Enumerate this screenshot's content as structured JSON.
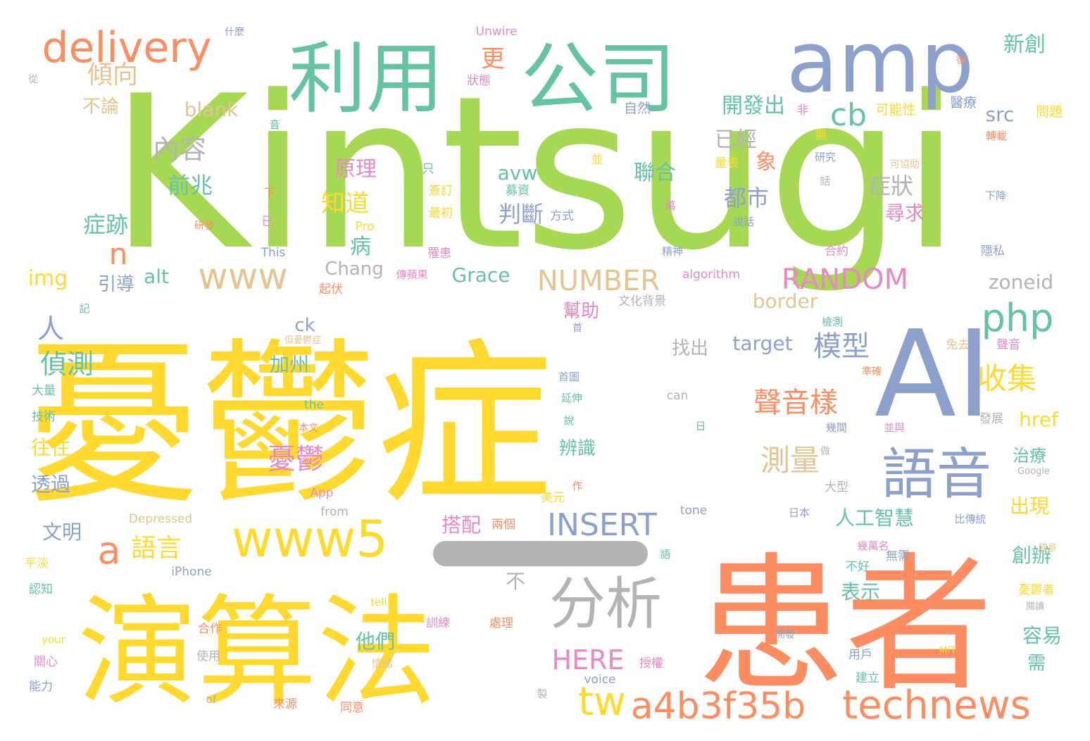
{
  "palette": {
    "green": "#a6d854",
    "yellow": "#ffd92f",
    "orange": "#fc8d62",
    "blue": "#8da0cb",
    "teal": "#66c2a5",
    "pink": "#e78ac3",
    "tan": "#e5c494",
    "gray": "#b3b3b3"
  },
  "words": [
    {
      "text": "Kintsugi",
      "color": "green"
    },
    {
      "text": "憂鬱症",
      "color": "yellow"
    },
    {
      "text": "患者",
      "color": "orange"
    },
    {
      "text": "演算法",
      "color": "yellow"
    },
    {
      "text": "AI",
      "color": "blue"
    },
    {
      "text": "amp",
      "color": "blue"
    },
    {
      "text": "利用",
      "color": "teal"
    },
    {
      "text": "公司",
      "color": "teal"
    },
    {
      "text": "delivery",
      "color": "orange"
    },
    {
      "text": "分析",
      "color": "gray"
    },
    {
      "text": "語音",
      "color": "blue"
    },
    {
      "text": "www5",
      "color": "yellow"
    },
    {
      "text": "technews",
      "color": "orange"
    },
    {
      "text": "a4b3f35b",
      "color": "orange"
    },
    {
      "text": "tw",
      "color": "yellow"
    },
    {
      "text": "php",
      "color": "teal"
    },
    {
      "text": "www",
      "color": "tan"
    },
    {
      "text": "a",
      "color": "orange"
    },
    {
      "text": "n",
      "color": "orange"
    },
    {
      "text": "INSERT",
      "color": "blue"
    },
    {
      "text": "RANDOM",
      "color": "pink"
    },
    {
      "text": "NUMBER",
      "color": "tan"
    },
    {
      "text": "HERE",
      "color": "pink"
    },
    {
      "text": "cb",
      "color": "teal"
    },
    {
      "text": "傾向",
      "color": "tan"
    },
    {
      "text": "更",
      "color": "orange"
    },
    {
      "text": "內容",
      "color": "gray"
    },
    {
      "text": "聲音樣",
      "color": "orange"
    },
    {
      "text": "模型",
      "color": "blue"
    },
    {
      "text": "收集",
      "color": "yellow"
    },
    {
      "text": "測量",
      "color": "tan"
    },
    {
      "text": "憂鬱",
      "color": "pink"
    },
    {
      "text": "偵測",
      "color": "teal"
    },
    {
      "text": "語言",
      "color": "yellow"
    },
    {
      "text": "人",
      "color": "blue"
    },
    {
      "text": "前兆",
      "color": "teal"
    },
    {
      "text": "症跡",
      "color": "teal"
    },
    {
      "text": "知道",
      "color": "yellow"
    },
    {
      "text": "判斷",
      "color": "blue"
    },
    {
      "text": "都市",
      "color": "blue"
    },
    {
      "text": "症狀",
      "color": "gray"
    },
    {
      "text": "開發出",
      "color": "teal"
    },
    {
      "text": "已經",
      "color": "gray"
    },
    {
      "text": "聯合",
      "color": "teal"
    },
    {
      "text": "象",
      "color": "orange"
    },
    {
      "text": "尋求",
      "color": "pink"
    },
    {
      "text": "新創",
      "color": "teal"
    },
    {
      "text": "原理",
      "color": "pink"
    },
    {
      "text": "病",
      "color": "teal"
    },
    {
      "text": "avw",
      "color": "teal"
    },
    {
      "text": "blank",
      "color": "tan"
    },
    {
      "text": "src",
      "color": "blue"
    },
    {
      "text": "img",
      "color": "yellow"
    },
    {
      "text": "alt",
      "color": "teal"
    },
    {
      "text": "Chang",
      "color": "gray"
    },
    {
      "text": "Grace",
      "color": "teal"
    },
    {
      "text": "zoneid",
      "color": "gray"
    },
    {
      "text": "border",
      "color": "tan"
    },
    {
      "text": "ck",
      "color": "blue"
    },
    {
      "text": "target",
      "color": "blue"
    },
    {
      "text": "href",
      "color": "yellow"
    },
    {
      "text": "引導",
      "color": "blue"
    },
    {
      "text": "不論",
      "color": "tan"
    },
    {
      "text": "幫助",
      "color": "pink"
    },
    {
      "text": "找出",
      "color": "gray"
    },
    {
      "text": "加州",
      "color": "teal"
    },
    {
      "text": "人工智慧",
      "color": "teal"
    },
    {
      "text": "出現",
      "color": "yellow"
    },
    {
      "text": "搭配",
      "color": "pink"
    },
    {
      "text": "往往",
      "color": "yellow"
    },
    {
      "text": "透過",
      "color": "blue"
    },
    {
      "text": "文明",
      "color": "blue"
    },
    {
      "text": "表示",
      "color": "teal"
    },
    {
      "text": "容易",
      "color": "teal"
    },
    {
      "text": "創辦",
      "color": "teal"
    },
    {
      "text": "需",
      "color": "teal"
    },
    {
      "text": "他們",
      "color": "teal"
    },
    {
      "text": "不",
      "color": "gray"
    },
    {
      "text": "治療",
      "color": "teal"
    },
    {
      "text": "辨識",
      "color": "teal"
    },
    {
      "text": "Unwire",
      "color": "pink"
    },
    {
      "text": "什麼",
      "color": "blue"
    },
    {
      "text": "從",
      "color": "gray"
    },
    {
      "text": "狀態",
      "color": "pink"
    },
    {
      "text": "自然",
      "color": "blue"
    },
    {
      "text": "非",
      "color": "pink"
    },
    {
      "text": "可能性",
      "color": "yellow"
    },
    {
      "text": "醫療",
      "color": "blue"
    },
    {
      "text": "問題",
      "color": "yellow"
    },
    {
      "text": "後",
      "color": "orange"
    },
    {
      "text": "轉載",
      "color": "orange"
    },
    {
      "text": "音",
      "color": "teal"
    },
    {
      "text": "無",
      "color": "yellow"
    },
    {
      "text": "研究",
      "color": "blue"
    },
    {
      "text": "並",
      "color": "yellow"
    },
    {
      "text": "量表",
      "color": "yellow"
    },
    {
      "text": "可協助",
      "color": "tan"
    },
    {
      "text": "只",
      "color": "teal"
    },
    {
      "text": "簽訂",
      "color": "yellow"
    },
    {
      "text": "最初",
      "color": "yellow"
    },
    {
      "text": "募資",
      "color": "teal"
    },
    {
      "text": "話",
      "color": "gray"
    },
    {
      "text": "下降",
      "color": "blue"
    },
    {
      "text": "下",
      "color": "orange"
    },
    {
      "text": "已",
      "color": "pink"
    },
    {
      "text": "研發",
      "color": "orange"
    },
    {
      "text": "Pro",
      "color": "yellow"
    },
    {
      "text": "方式",
      "color": "blue"
    },
    {
      "text": "萬",
      "color": "pink"
    },
    {
      "text": "說話",
      "color": "blue"
    },
    {
      "text": "This",
      "color": "blue"
    },
    {
      "text": "罹患",
      "color": "pink"
    },
    {
      "text": "精神",
      "color": "blue"
    },
    {
      "text": "合約",
      "color": "pink"
    },
    {
      "text": "隱私",
      "color": "blue"
    },
    {
      "text": "傳蘋果",
      "color": "pink"
    },
    {
      "text": "algorithm",
      "color": "pink"
    },
    {
      "text": "起伏",
      "color": "orange"
    },
    {
      "text": "文化背景",
      "color": "gray"
    },
    {
      "text": "記",
      "color": "teal"
    },
    {
      "text": "但憂鬱症",
      "color": "tan"
    },
    {
      "text": "正",
      "color": "gray"
    },
    {
      "text": "首",
      "color": "blue"
    },
    {
      "text": "檢測",
      "color": "teal"
    },
    {
      "text": "免去",
      "color": "tan"
    },
    {
      "text": "聲音",
      "color": "pink"
    },
    {
      "text": "準確",
      "color": "orange"
    },
    {
      "text": "首圖",
      "color": "blue"
    },
    {
      "text": "延伸",
      "color": "teal"
    },
    {
      "text": "大量",
      "color": "teal"
    },
    {
      "text": "技術",
      "color": "teal"
    },
    {
      "text": "the",
      "color": "teal"
    },
    {
      "text": "can",
      "color": "gray"
    },
    {
      "text": "本文",
      "color": "orange"
    },
    {
      "text": "說",
      "color": "teal"
    },
    {
      "text": "日",
      "color": "teal"
    },
    {
      "text": "幾間",
      "color": "blue"
    },
    {
      "text": "發展",
      "color": "gray"
    },
    {
      "text": "並與",
      "color": "pink"
    },
    {
      "text": "作",
      "color": "orange"
    },
    {
      "text": "做",
      "color": "gray"
    },
    {
      "text": "Google",
      "color": "gray"
    },
    {
      "text": "App",
      "color": "pink"
    },
    {
      "text": "from",
      "color": "gray"
    },
    {
      "text": "大型",
      "color": "gray"
    },
    {
      "text": "Depressed",
      "color": "tan"
    },
    {
      "text": "美元",
      "color": "yellow"
    },
    {
      "text": "tone",
      "color": "blue"
    },
    {
      "text": "日本",
      "color": "blue"
    },
    {
      "text": "比傳統",
      "color": "blue"
    },
    {
      "text": "兩個",
      "color": "orange"
    },
    {
      "text": "隨意",
      "color": "tan"
    },
    {
      "text": "平淡",
      "color": "yellow"
    },
    {
      "text": "語",
      "color": "teal"
    },
    {
      "text": "幾萬名",
      "color": "pink"
    },
    {
      "text": "無需",
      "color": "blue"
    },
    {
      "text": "iPhone",
      "color": "blue"
    },
    {
      "text": "不好",
      "color": "teal"
    },
    {
      "text": "認知",
      "color": "teal"
    },
    {
      "text": "憂鬱者",
      "color": "yellow"
    },
    {
      "text": "tell",
      "color": "yellow"
    },
    {
      "text": "閱讀",
      "color": "gray"
    },
    {
      "text": "訓練",
      "color": "pink"
    },
    {
      "text": "處理",
      "color": "orange"
    },
    {
      "text": "合作",
      "color": "orange"
    },
    {
      "text": "開發",
      "color": "blue"
    },
    {
      "text": "your",
      "color": "yellow"
    },
    {
      "text": "使用",
      "color": "gray"
    },
    {
      "text": "MIT",
      "color": "yellow"
    },
    {
      "text": "授權",
      "color": "pink"
    },
    {
      "text": "用戶",
      "color": "blue"
    },
    {
      "text": "關心",
      "color": "pink"
    },
    {
      "text": "情緒",
      "color": "tan"
    },
    {
      "text": "建立",
      "color": "teal"
    },
    {
      "text": "voice",
      "color": "blue"
    },
    {
      "text": "能力",
      "color": "blue"
    },
    {
      "text": "製",
      "color": "gray"
    },
    {
      "text": "of",
      "color": "gray"
    },
    {
      "text": "來源",
      "color": "orange"
    },
    {
      "text": "同意",
      "color": "orange"
    },
    {
      "text": "—",
      "color": "gray"
    }
  ]
}
